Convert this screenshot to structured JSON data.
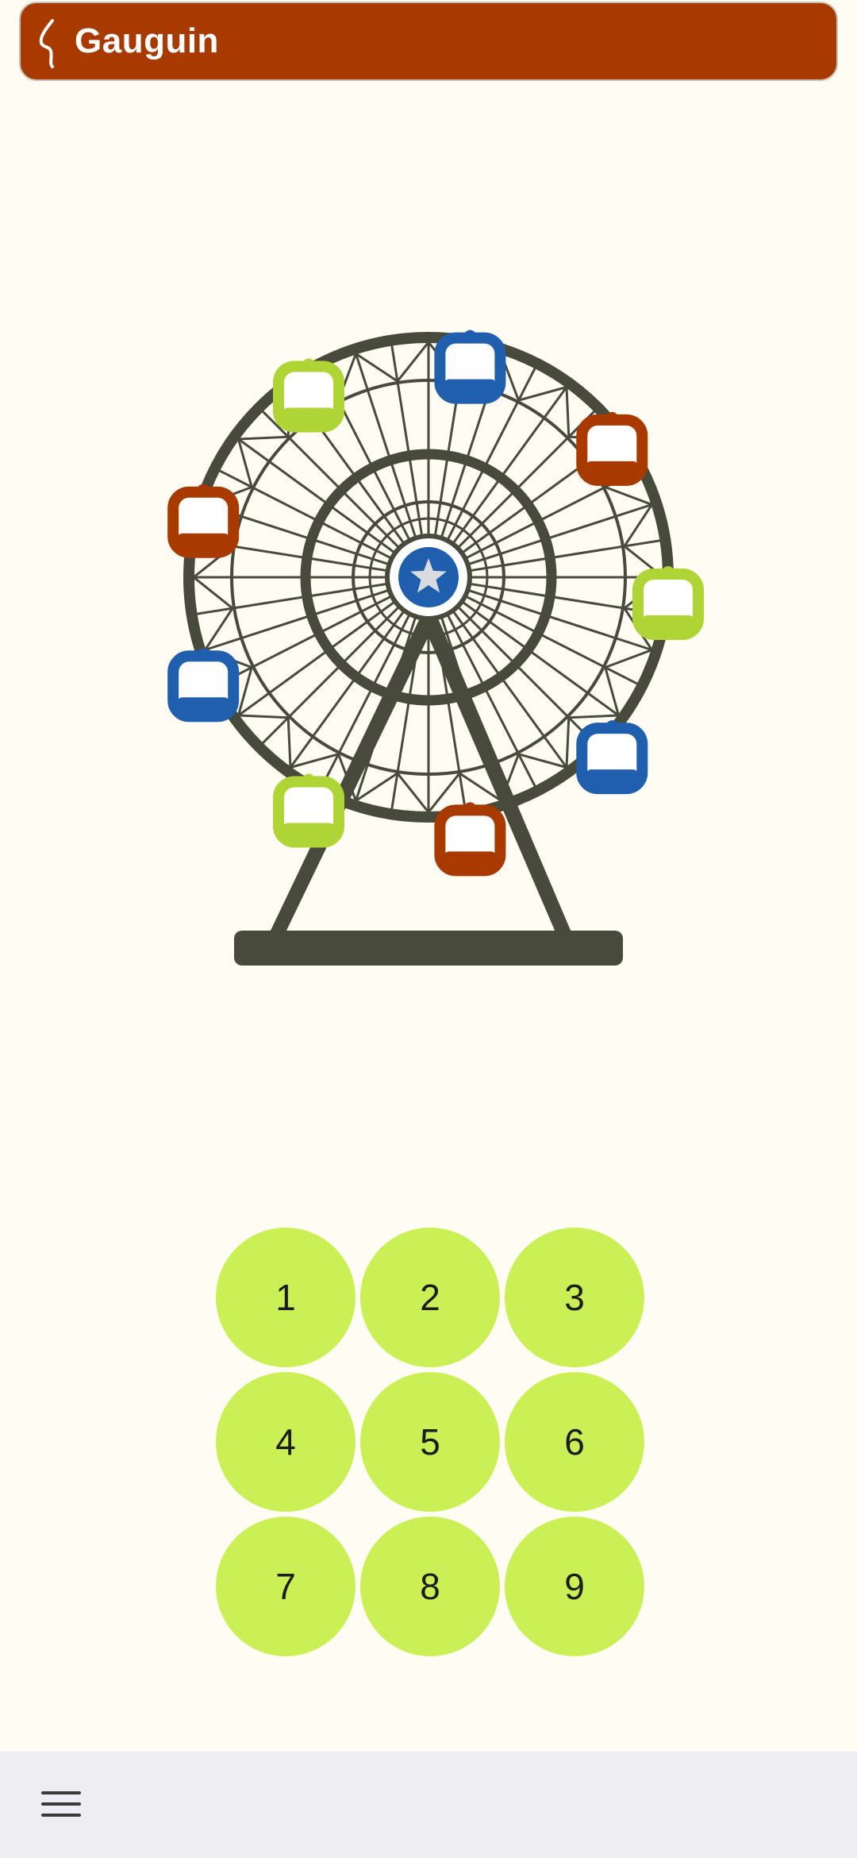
{
  "app_bar": {
    "title": "Gauguin",
    "logo_icon": "gauguin-logo-icon",
    "background": "#A83A00"
  },
  "illustration": {
    "name": "ferris-wheel",
    "structure_color": "#484A3C",
    "hub_icon": "star-icon",
    "hub_color": "#1F5FAD",
    "gondola_colors": [
      "#1F5FAD",
      "#A83A00",
      "#AED435",
      "#1F5FAD",
      "#A83A00",
      "#AED435",
      "#1F5FAD",
      "#A83A00",
      "#AED435"
    ]
  },
  "keypad": {
    "keys": [
      "1",
      "2",
      "3",
      "4",
      "5",
      "6",
      "7",
      "8",
      "9"
    ],
    "key_color": "#CBF056"
  },
  "bottom_bar": {
    "menu_icon": "hamburger-menu-icon"
  }
}
